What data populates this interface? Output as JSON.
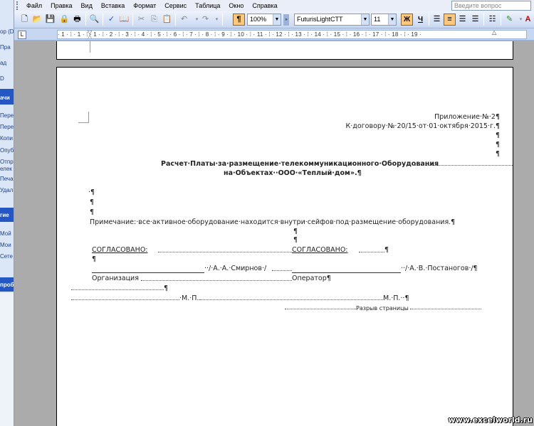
{
  "left_panel": {
    "lines": [
      "ор (D",
      "Пра",
      "ад",
      "D",
      "ачи",
      "Пере",
      "Пере",
      "Копи",
      "Опуб",
      "Отпр",
      "елек",
      "Печа",
      "Удал",
      "гие",
      "Мой",
      "Мои",
      "Сете",
      "проб"
    ]
  },
  "menubar": {
    "items": [
      "Файл",
      "Правка",
      "Вид",
      "Вставка",
      "Формат",
      "Сервис",
      "Таблица",
      "Окно",
      "Справка"
    ],
    "help_placeholder": "Введите вопрос"
  },
  "toolbar": {
    "zoom": "100%",
    "font_name": "FuturisLightCTT",
    "font_size": "11",
    "bold_label": "Ж",
    "underline_label": "Ч",
    "pilcrow": "¶"
  },
  "ruler": {
    "tab_selector": "L",
    "marks": "· 1 · ⁞ · 1 · ⁞ · 1 · ⁞ · 2 · ⁞ · 3 · ⁞ · 4 · ⁞ · 5 · ⁞ · 6 · ⁞ · 7 · ⁞ · 8 · ⁞ · 9 · ⁞ · 10 · ⁞ · 11 · ⁞ · 12 · ⁞ · 13 · ⁞ · 14 · ⁞ · 15 · ⁞ · 16 · ⁞ · 17 · ⁞ · 18 · ⁞ · 19 ·"
  },
  "document": {
    "appendix": "Приложение·№·2¶",
    "contract": "К·договору·№·20/15·от·01·октября·2015·г.¶",
    "pilcrow": "¶",
    "title_line1": "Расчет·Платы·за·размещение·телекоммуникационного·Оборудования",
    "title_line2": "на·Объектах··ООО·«Теплый·дом».¶",
    "empty_para1": "·¶",
    "note": "Примечание:·все·активное·оборудование·находится·внутри·сейфов·под·размещение·оборудования.¶",
    "agreed_left": "СОГЛАСОВАНО:",
    "agreed_right": "СОГЛАСОВАНО:",
    "signature_left": "··/·А.·А.·Смирнов·/",
    "signature_right": "··/·А.·В.·Постаногов·/¶",
    "org_left": "Организация",
    "org_right": "Оператор¶",
    "stamp_left": "·М.·П.",
    "stamp_right": "М.·П.··¶",
    "page_break": "Разрыв страницы"
  },
  "watermark": "www.excelworld.ru"
}
